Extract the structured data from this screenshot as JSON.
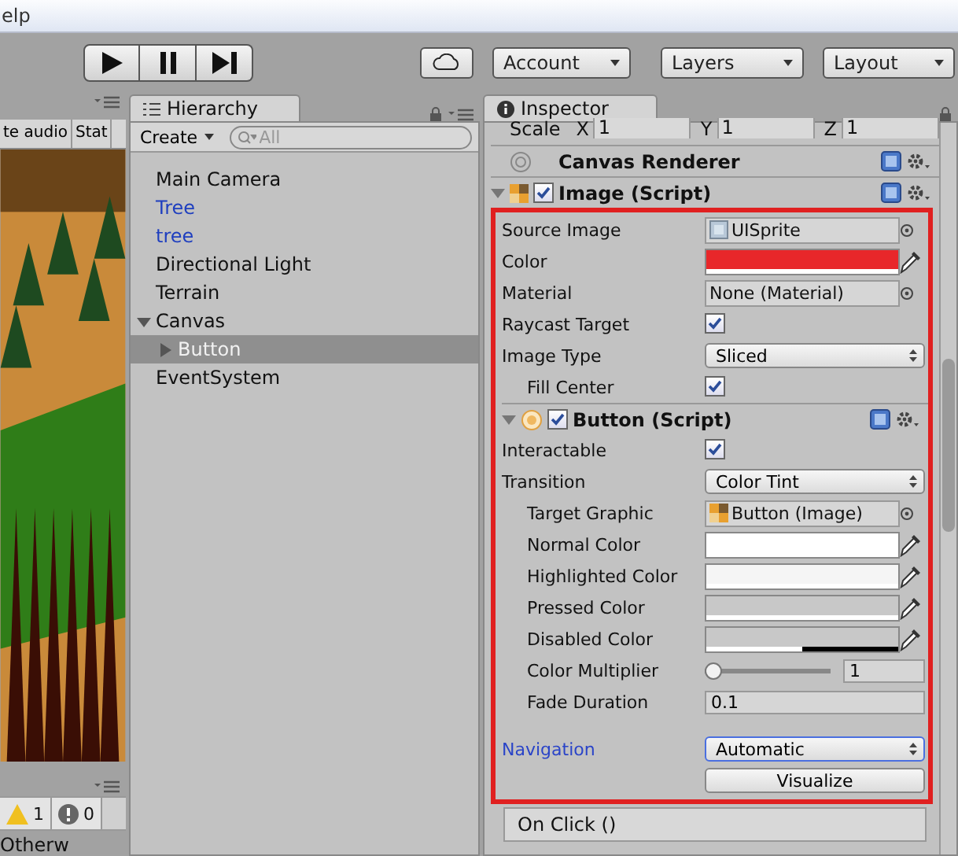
{
  "menu_bar": {
    "item": "elp"
  },
  "toolbar": {
    "dropdowns": [
      "Account",
      "Layers",
      "Layout"
    ]
  },
  "game_panel": {
    "tabs": [
      "te audio",
      "Stat"
    ],
    "console": {
      "warnings": "1",
      "errors": "0",
      "message": "Otherw"
    }
  },
  "hierarchy": {
    "title": "Hierarchy",
    "create": "Create",
    "search": {
      "placeholder": "All"
    },
    "items": [
      {
        "label": "Main Camera",
        "kind": "object",
        "selected": false
      },
      {
        "label": "Tree",
        "kind": "prefab",
        "selected": false
      },
      {
        "label": "tree",
        "kind": "prefab",
        "selected": false
      },
      {
        "label": "Directional Light",
        "kind": "object",
        "selected": false
      },
      {
        "label": "Terrain",
        "kind": "object",
        "selected": false
      },
      {
        "label": "Canvas",
        "kind": "object",
        "selected": false,
        "expanded": true,
        "children": [
          {
            "label": "Button",
            "kind": "object",
            "selected": true,
            "expanded": false
          }
        ]
      },
      {
        "label": "EventSystem",
        "kind": "object",
        "selected": false
      }
    ]
  },
  "inspector": {
    "title": "Inspector",
    "scale": {
      "label": "Scale",
      "axes": [
        {
          "axis": "X",
          "value": "1"
        },
        {
          "axis": "Y",
          "value": "1"
        },
        {
          "axis": "Z",
          "value": "1"
        }
      ]
    },
    "components": [
      {
        "title": "Canvas Renderer",
        "kind": "renderer"
      },
      {
        "title": "Image (Script)",
        "kind": "image",
        "expanded": true,
        "enabled": true,
        "fields": [
          {
            "label": "Source Image",
            "kind": "sprite",
            "value": "UISprite",
            "indented": false
          },
          {
            "label": "Color",
            "kind": "color",
            "color": "#e8272a",
            "level": 1,
            "indented": false
          },
          {
            "label": "Material",
            "kind": "object",
            "value": "None (Material)",
            "indented": false
          },
          {
            "label": "Raycast Target",
            "kind": "checkbox",
            "checked": true,
            "indented": false
          },
          {
            "label": "Image Type",
            "kind": "dropdown",
            "value": "Sliced",
            "focused": false,
            "indented": false
          },
          {
            "label": "Fill Center",
            "kind": "checkbox",
            "checked": true,
            "indented": true
          }
        ]
      },
      {
        "title": "Button (Script)",
        "kind": "button",
        "expanded": true,
        "enabled": true,
        "fields": [
          {
            "label": "Interactable",
            "kind": "checkbox",
            "checked": true,
            "indented": false
          },
          {
            "label": "Transition",
            "kind": "dropdown",
            "value": "Color Tint",
            "focused": false,
            "indented": false
          },
          {
            "label": "Target Graphic",
            "kind": "reference",
            "value": "Button (Image)",
            "indented": true
          },
          {
            "label": "Normal Color",
            "kind": "color",
            "color": "#ffffff",
            "level": 1,
            "indented": true
          },
          {
            "label": "Highlighted Color",
            "kind": "color",
            "color": "#f5f5f5",
            "level": 1,
            "indented": true
          },
          {
            "label": "Pressed Color",
            "kind": "color",
            "color": "#c8c8c8",
            "level": 1,
            "indented": true
          },
          {
            "label": "Disabled Color",
            "kind": "color",
            "color": "#c8c8c8",
            "level": 0.5,
            "indented": true
          },
          {
            "label": "Color Multiplier",
            "kind": "slider",
            "level": 0,
            "value": "1",
            "indented": true
          },
          {
            "label": "Fade Duration",
            "kind": "number",
            "value": "0.1",
            "indented": true
          },
          {
            "label": "Navigation",
            "kind": "dropdown",
            "value": "Automatic",
            "focused": true,
            "indented": false,
            "spaced": true
          },
          {
            "kind": "button",
            "value": "Visualize"
          }
        ]
      }
    ],
    "event": {
      "label": "On Click ()"
    }
  }
}
